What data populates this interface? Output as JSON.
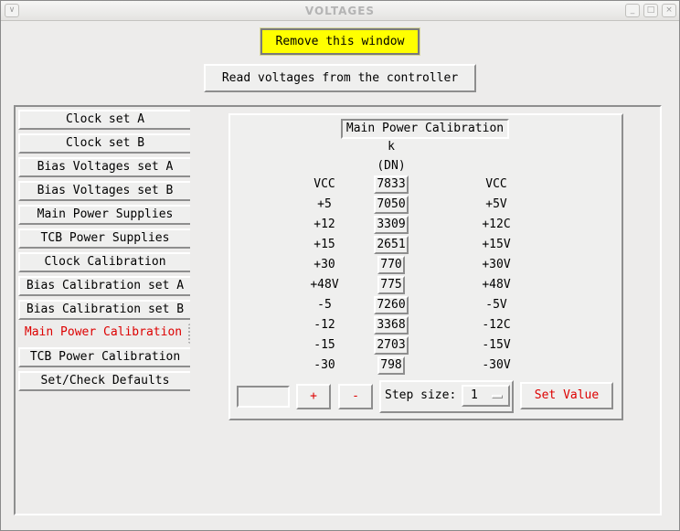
{
  "window": {
    "title": "VOLTAGES",
    "menu_glyph": "∨",
    "controls": {
      "minimize": "_",
      "maximize": "□",
      "close": "×"
    }
  },
  "buttons": {
    "remove": "Remove this window",
    "read": "Read voltages from the controller",
    "plus": "+",
    "minus": "-",
    "set_value": "Set Value"
  },
  "colors": {
    "remove_bg": "#ffff00",
    "active_tab": "#dd0000",
    "accent_text": "#dd0000"
  },
  "tabs": [
    {
      "label": "Clock set A",
      "active": false
    },
    {
      "label": "Clock set B",
      "active": false
    },
    {
      "label": "Bias Voltages set A",
      "active": false
    },
    {
      "label": "Bias Voltages set B",
      "active": false
    },
    {
      "label": "Main Power Supplies",
      "active": false
    },
    {
      "label": "TCB Power Supplies",
      "active": false
    },
    {
      "label": "Clock Calibration",
      "active": false
    },
    {
      "label": "Bias Calibration set A",
      "active": false
    },
    {
      "label": "Bias Calibration set B",
      "active": false
    },
    {
      "label": "Main Power Calibration",
      "active": true
    },
    {
      "label": "TCB Power Calibration",
      "active": false
    },
    {
      "label": "Set/Check Defaults",
      "active": false
    }
  ],
  "panel": {
    "title": "Main Power Calibration",
    "k_label": "k",
    "unit_label": "(DN)",
    "left_header": "VCC",
    "right_header": "VCC",
    "rows": [
      {
        "left": "+5",
        "value": "7050",
        "right": "+5V"
      },
      {
        "left": "+12",
        "value": "3309",
        "right": "+12C"
      },
      {
        "left": "+15",
        "value": "2651",
        "right": "+15V"
      },
      {
        "left": "+30",
        "value": "770",
        "right": "+30V"
      },
      {
        "left": "+48V",
        "value": "775",
        "right": "+48V"
      },
      {
        "left": "-5",
        "value": "7260",
        "right": "-5V"
      },
      {
        "left": "-12",
        "value": "3368",
        "right": "-12C"
      },
      {
        "left": "-15",
        "value": "2703",
        "right": "-15V"
      },
      {
        "left": "-30",
        "value": "798",
        "right": "-30V"
      }
    ],
    "header_value": "7833"
  },
  "controls": {
    "entry_value": "",
    "step_label": "Step size:",
    "step_value": "1"
  }
}
